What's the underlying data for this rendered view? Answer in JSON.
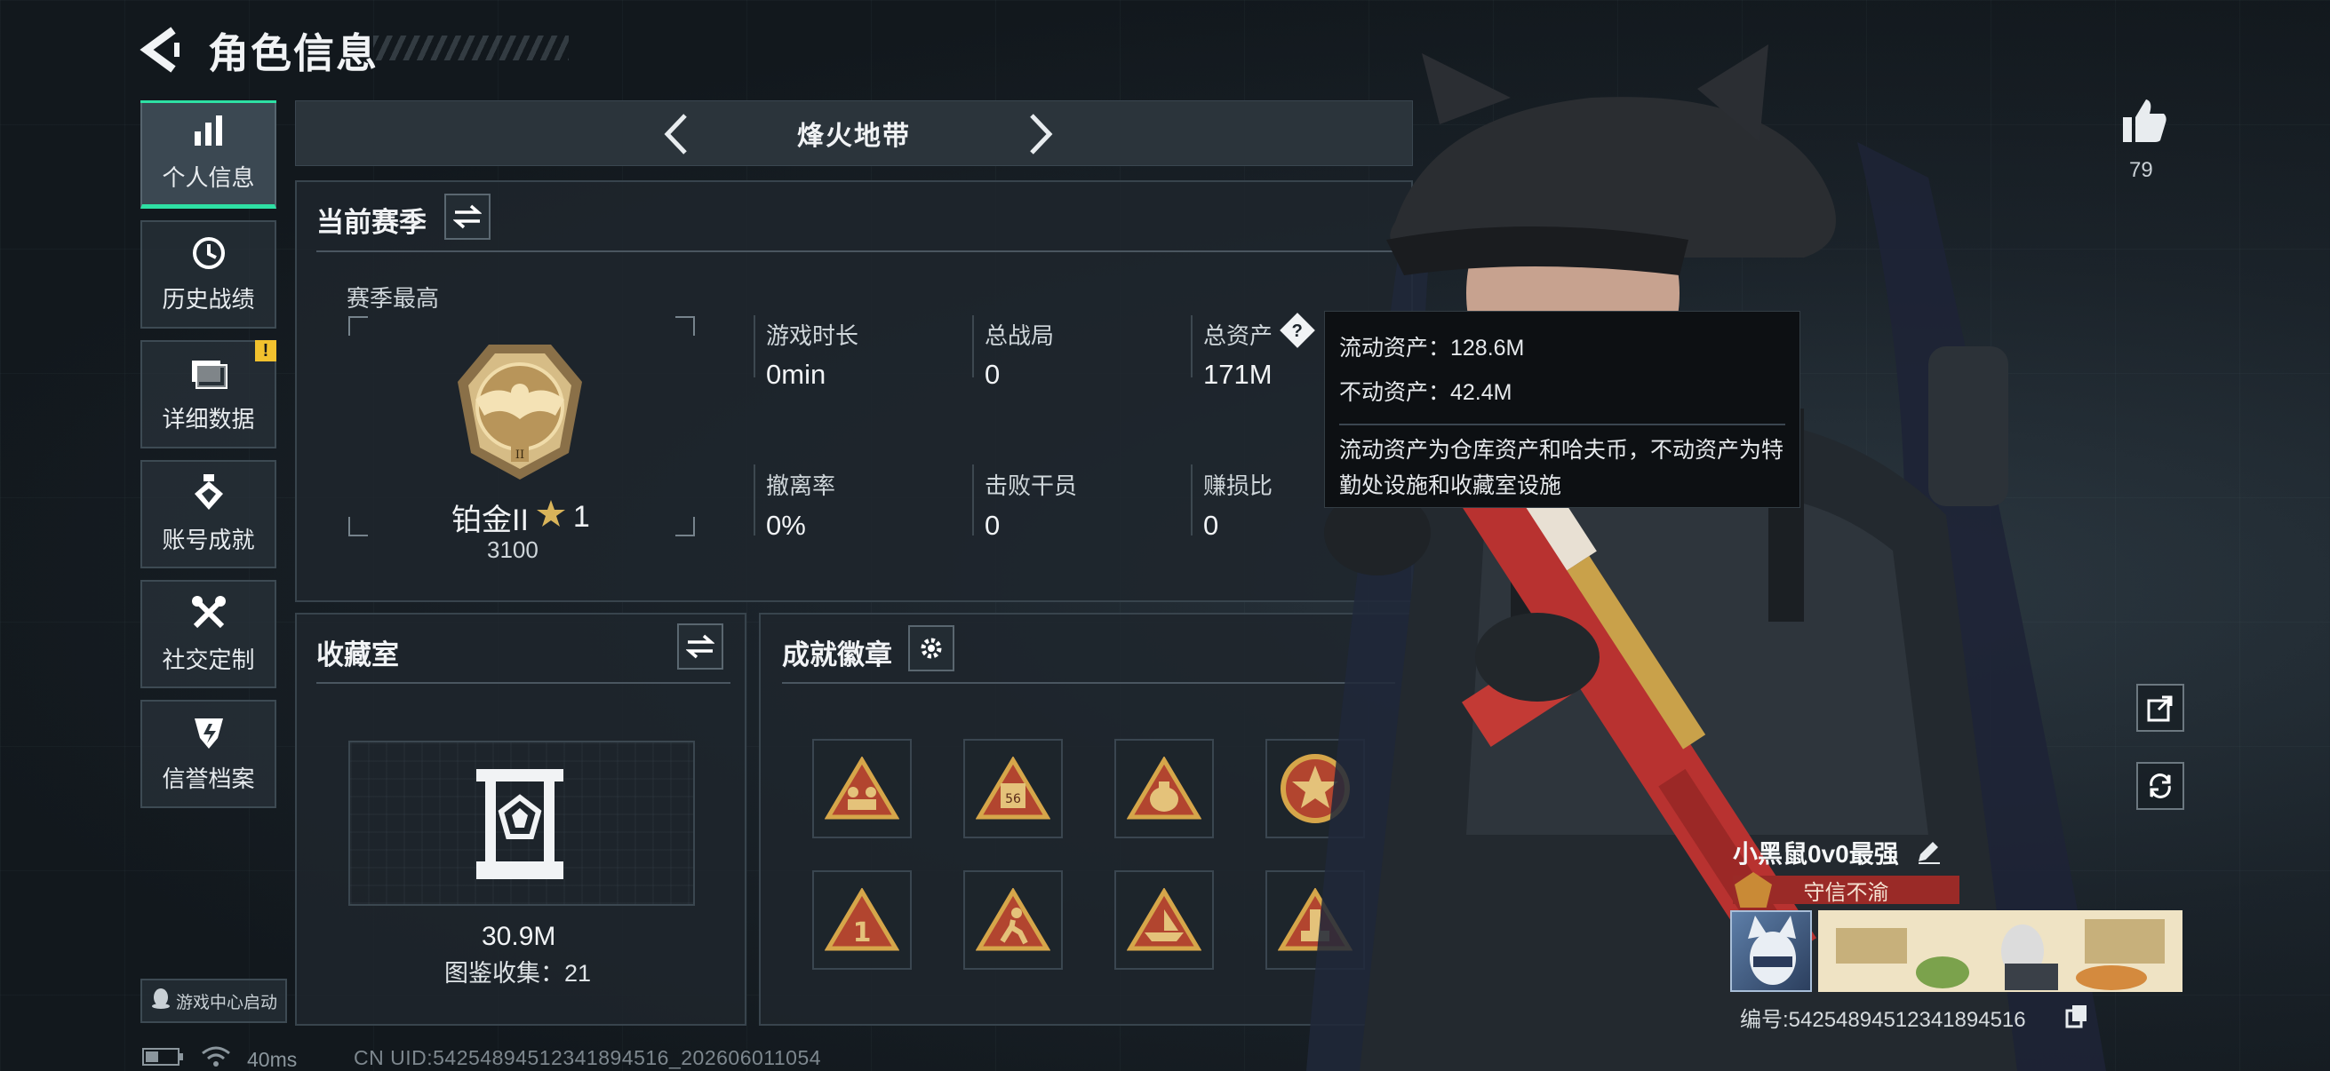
{
  "header": {
    "title": "角色信息"
  },
  "sidebar": {
    "items": [
      {
        "label": "个人信息",
        "icon": "bar-chart-icon"
      },
      {
        "label": "历史战绩",
        "icon": "history-clock-icon"
      },
      {
        "label": "详细数据",
        "icon": "data-folder-icon",
        "badge": "!"
      },
      {
        "label": "账号成就",
        "icon": "medal-icon"
      },
      {
        "label": "社交定制",
        "icon": "tools-icon"
      },
      {
        "label": "信誉档案",
        "icon": "credit-shield-icon"
      }
    ],
    "launch_label": "游戏中心启动"
  },
  "mode": {
    "label": "烽火地带"
  },
  "season": {
    "title": "当前赛季",
    "best_label": "赛季最高",
    "rank_name": "铂金II",
    "rank_stars": "1",
    "rank_points": "3100",
    "stats": [
      {
        "label": "游戏时长",
        "value": "0min"
      },
      {
        "label": "总战局",
        "value": "0"
      },
      {
        "label": "总资产",
        "value": "171M"
      },
      {
        "label": "撤离率",
        "value": "0%"
      },
      {
        "label": "击败干员",
        "value": "0"
      },
      {
        "label": "赚损比",
        "value": "0"
      }
    ]
  },
  "tooltip": {
    "liquid": "流动资产：128.6M",
    "fixed": "不动资产：42.4M",
    "desc": "流动资产为仓库资产和哈夫币，不动资产为特勤处设施和收藏室设施"
  },
  "collection": {
    "title": "收藏室",
    "value": "30.9M",
    "index": "图鉴收集：21"
  },
  "achievements": {
    "title": "成就徽章",
    "badge_icons": [
      "badge-team-icon",
      "badge-56-icon",
      "badge-bag-icon",
      "badge-star-emblem-icon",
      "badge-1-icon",
      "badge-runner-icon",
      "badge-boat-icon",
      "badge-tower-icon"
    ]
  },
  "player": {
    "likes": "79",
    "name": "小黑鼠0v0最强",
    "honor": "守信不渝",
    "id": "编号:5425489451234189451​6"
  },
  "status": {
    "ping": "40ms",
    "uid": "CN UID:542548945123418945​16_202606011054"
  },
  "colors": {
    "accent": "#2ee0a4",
    "warning": "#f2c12e",
    "honor": "#9a2a27",
    "gold": "#c9a14a"
  }
}
